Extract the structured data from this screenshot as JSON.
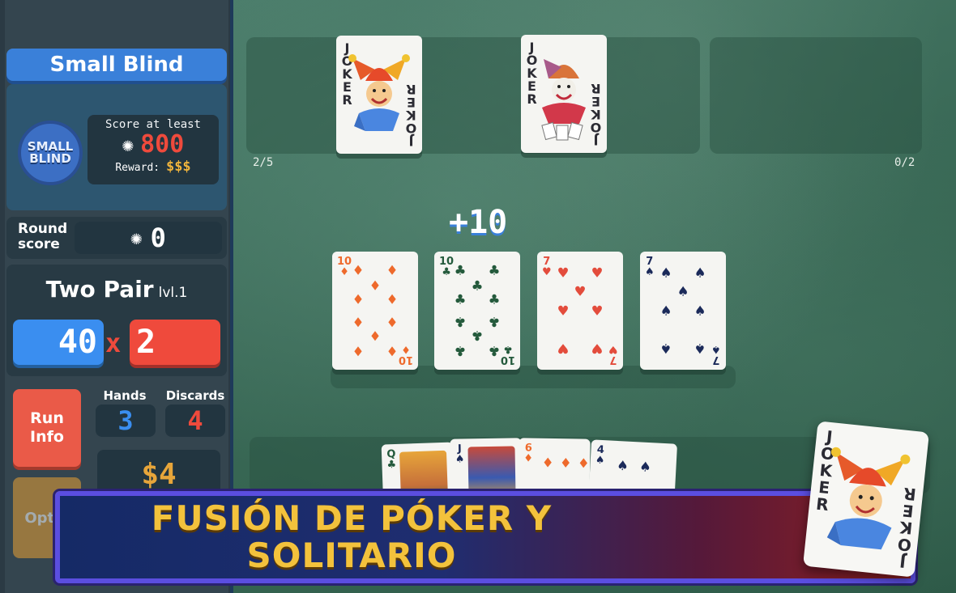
{
  "blind": {
    "title": "Small Blind",
    "chip_label": "SMALL BLIND",
    "score_label": "Score at least",
    "score_target": "800",
    "reward_label": "Reward:",
    "reward_value": "$$$"
  },
  "round": {
    "label": "Round score",
    "value": "0"
  },
  "hand": {
    "name": "Two Pair",
    "level": "lvl.1",
    "chips": "40",
    "times": "x",
    "mult": "2"
  },
  "buttons": {
    "run_info": "Run Info",
    "options": "Optio"
  },
  "stats": {
    "hands_label": "Hands",
    "hands_value": "3",
    "discards_label": "Discards",
    "discards_value": "4",
    "money": "$4"
  },
  "jokers": {
    "count": "2/5",
    "consumables_count": "0/2",
    "label": "JOKER"
  },
  "played": {
    "bonus": "+10",
    "cards": [
      {
        "rank": "10",
        "suit": "♦",
        "color": "#ee6a2c"
      },
      {
        "rank": "10",
        "suit": "♣",
        "color": "#245a3c"
      },
      {
        "rank": "7",
        "suit": "♥",
        "color": "#e34c3c"
      },
      {
        "rank": "7",
        "suit": "♠",
        "color": "#1b2a5a"
      }
    ]
  },
  "hand_cards": [
    {
      "rank": "Q",
      "suit": "♣"
    },
    {
      "rank": "J",
      "suit": "♠"
    },
    {
      "rank": "6",
      "suit": "♦"
    },
    {
      "rank": "4",
      "suit": "♠"
    }
  ],
  "banner": {
    "line1": "FUSIÓN DE PÓKER Y",
    "line2": "SOLITARIO"
  },
  "colors": {
    "felt": "#376653",
    "chips_blue": "#3a8ef0",
    "mult_red": "#ef4a3c",
    "gold": "#f3c23c"
  }
}
